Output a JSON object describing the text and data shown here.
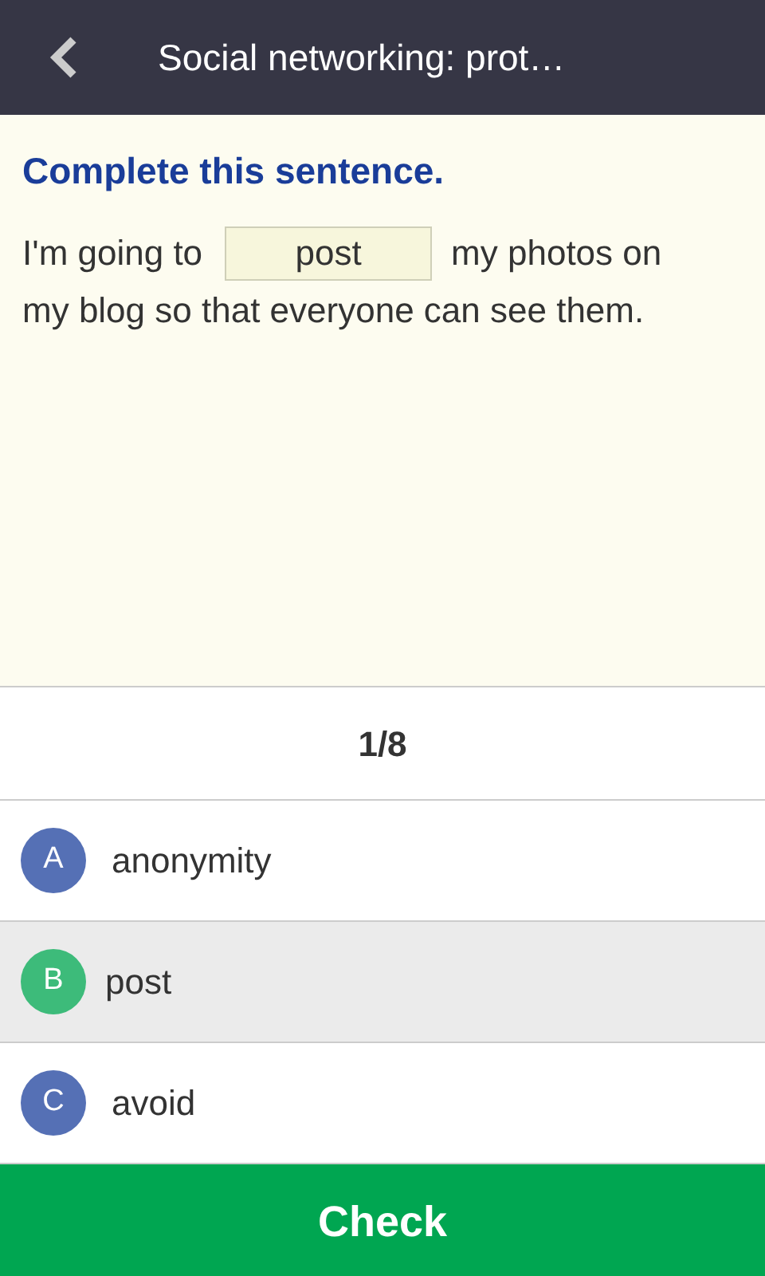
{
  "header": {
    "title": "Social networking: prot…"
  },
  "question": {
    "instruction": "Complete this sentence.",
    "before": "I'm going to",
    "blank": {
      "value": "post"
    },
    "after_lines": [
      "my photos on",
      "my blog so that everyone can see them."
    ]
  },
  "progress": "1/8",
  "options": [
    {
      "letter": "A",
      "text": "anonymity",
      "selected": false
    },
    {
      "letter": "B",
      "text": "post",
      "selected": true
    },
    {
      "letter": "C",
      "text": "avoid",
      "selected": false
    }
  ],
  "check_button": "Check"
}
